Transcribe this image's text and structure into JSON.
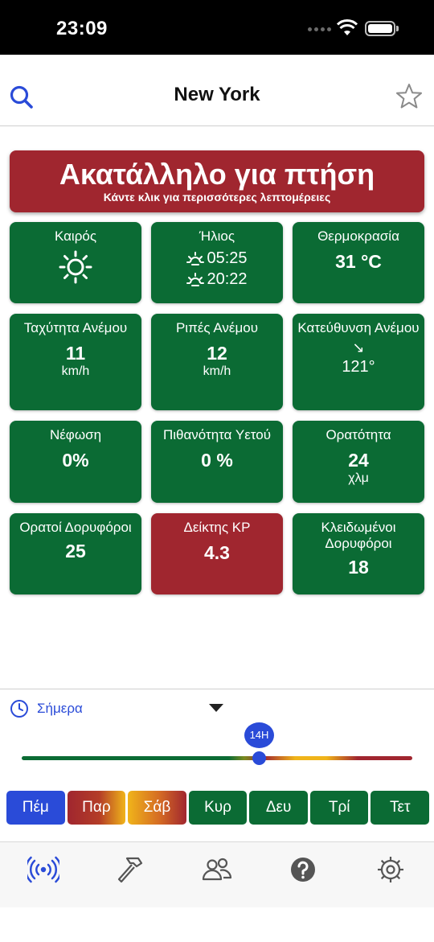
{
  "status_bar": {
    "time": "23:09"
  },
  "header": {
    "title": "New York"
  },
  "alert": {
    "title": "Ακατάλληλο για πτήση",
    "subtitle": "Κάντε κλικ για περισσότερες λεπτομέρειες",
    "color": "#a0262f"
  },
  "tiles": [
    {
      "label": "Καιρός",
      "icon": "sun-icon",
      "status": "green"
    },
    {
      "label": "Ήλιος",
      "sunrise": "05:25",
      "sunset": "20:22",
      "status": "green"
    },
    {
      "label": "Θερμοκρασία",
      "value": "31 °C",
      "status": "green"
    },
    {
      "label": "Ταχύτητα Ανέμου",
      "value": "11",
      "unit": "km/h",
      "status": "green"
    },
    {
      "label": "Ριπές Ανέμου",
      "value": "12",
      "unit": "km/h",
      "status": "green"
    },
    {
      "label": "Κατεύθυνση Ανέμου",
      "arrow": "↘",
      "value": "121°",
      "status": "green"
    },
    {
      "label": "Νέφωση",
      "value": "0%",
      "status": "green"
    },
    {
      "label": "Πιθανότητα Υετού",
      "value": "0 %",
      "status": "green"
    },
    {
      "label": "Ορατότητα",
      "value": "24",
      "unit": "χλμ",
      "status": "green"
    },
    {
      "label": "Ορατοί Δορυφόροι",
      "value": "25",
      "status": "green"
    },
    {
      "label": "Δείκτης ΚΡ",
      "value": "4.3",
      "status": "red"
    },
    {
      "label": "Κλειδωμένοι Δορυφόροι",
      "value": "18",
      "status": "green"
    }
  ],
  "time_selector": {
    "period": "Σήμερα",
    "hour_badge": "14H",
    "slider_position": 0.6
  },
  "days": [
    "Πέμ",
    "Παρ",
    "Σάβ",
    "Κυρ",
    "Δευ",
    "Τρί",
    "Τετ"
  ],
  "tab_icons": [
    "signal-broadcast-icon",
    "hammer-icon",
    "people-icon",
    "help-icon",
    "gear-icon"
  ],
  "colors": {
    "green": "#0b6b34",
    "red": "#a0262f",
    "yellow": "#f0b41a",
    "accent": "#2a4bd8"
  }
}
